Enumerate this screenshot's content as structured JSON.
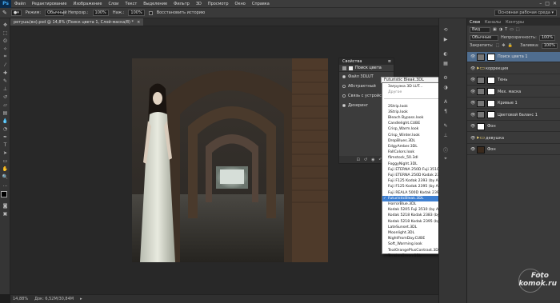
{
  "app": {
    "logo": "Ps"
  },
  "menu": [
    "Файл",
    "Редактирование",
    "Изображение",
    "Слои",
    "Текст",
    "Выделение",
    "Фильтр",
    "3D",
    "Просмотр",
    "Окно",
    "Справка"
  ],
  "window_controls": [
    "–",
    "□",
    "✕"
  ],
  "options": {
    "mode_label": "Режим:",
    "mode_value": "Обычный",
    "opacity_label": "Непрозр.:",
    "opacity_value": "100%",
    "flow_label": "Наж.:",
    "flow_value": "100%",
    "history_label": "Восстановить историю",
    "workspace": "Основная рабочая среда"
  },
  "document": {
    "tab_title": "ретушь(вн).psd @ 14,8% (Поиск цвета 1, Слой-маска/8) *",
    "close": "×",
    "status_zoom": "14,88%",
    "status_doc": "Док: 6,52М/30,84М"
  },
  "properties": {
    "title": "Свойства",
    "header_controls": "≡",
    "subtitle": "Поиск цвета",
    "options": [
      {
        "label": "Файл 3DLUT",
        "checked": true
      },
      {
        "label": "Абстрактный",
        "checked": false
      },
      {
        "label": "Связь с устройством",
        "checked": false
      },
      {
        "label": "Дизеринг",
        "checked": true
      }
    ],
    "select_value": "Futuristic Bleak.3DL",
    "bottom_icons": [
      "⊡",
      "↺",
      "◉",
      "↶",
      "🗑"
    ]
  },
  "dropdown": {
    "top_items": [
      "Загрузка 3D LUT...",
      "Другое"
    ],
    "items": [
      "2Strip.look",
      "3Strip.look",
      "Bleach Bypass.look",
      "Candlelight.CUBE",
      "Crisp_Warm.look",
      "Crisp_Winter.look",
      "DropBlues.3DL",
      "EdgyAmber.3DL",
      "FallColors.look",
      "filmstock_50.3dl",
      "FoggyNight.3DL",
      "Fuji ETERNA 250D Fuji 3510 (by Adobe).cube",
      "Fuji ETERNA 250D Kodak 2395 (by Adobe).cube",
      "Fuji F125 Kodak 2393 (by Adobe).cube",
      "Fuji F125 Kodak 2395 (by Adobe).cube",
      "Fuji REALA 500D Kodak 2393 (by Adobe).cube",
      "FuturisticBleak.3DL",
      "HorrorBlue.3DL",
      "Kodak 5205 Fuji 3510 (by Adobe).cube",
      "Kodak 5218 Kodak 2383 (by Adobe).cube",
      "Kodak 5218 Kodak 2395 (by Adobe).cube",
      "LateSunset.3DL",
      "Moonlight.3DL",
      "NightFromDay.CUBE",
      "Soft_Warming.look",
      "TealOrangePlusContrast.3DL",
      "TensionGreen.3DL"
    ],
    "selected": "FuturisticBleak.3DL"
  },
  "layers_panel": {
    "tabs": [
      "Слои",
      "Каналы",
      "Контуры"
    ],
    "kind_label": "Вид",
    "blend": "Обычные",
    "opacity_label": "Непрозрачность:",
    "opacity_value": "100%",
    "lock_label": "Закрепить:",
    "fill_label": "Заливка:",
    "fill_value": "100%",
    "layers": [
      {
        "name": "Поиск цвета 1",
        "thumb": "adj",
        "mask": true,
        "active": true
      },
      {
        "name": "коррекция",
        "thumb": "folder",
        "mask": false,
        "active": false
      },
      {
        "name": "Тень",
        "thumb": "adj",
        "mask": true,
        "active": false
      },
      {
        "name": "Мех. маска",
        "thumb": "adj",
        "mask": true,
        "active": false
      },
      {
        "name": "Кривые 1",
        "thumb": "adj",
        "mask": true,
        "active": false
      },
      {
        "name": "Цветовой баланс 1",
        "thumb": "adj",
        "mask": true,
        "active": false
      },
      {
        "name": "Фон",
        "thumb": "white",
        "mask": false,
        "active": false
      },
      {
        "name": "девушка",
        "thumb": "folder",
        "mask": false,
        "active": false
      },
      {
        "name": "Фон",
        "thumb": "dark",
        "mask": false,
        "active": false
      }
    ]
  },
  "watermark": {
    "line1": "Foto",
    "line2": "komok.ru"
  }
}
